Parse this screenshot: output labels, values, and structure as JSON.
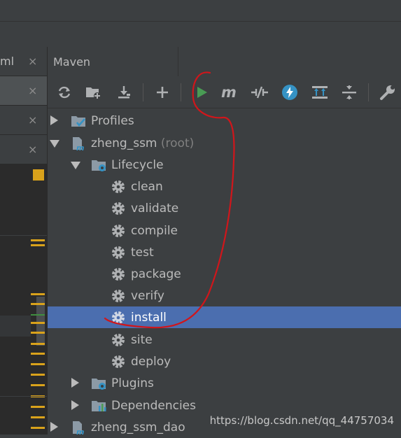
{
  "left_tabs": [
    {
      "label": "ml",
      "close": "×"
    },
    {
      "label": "",
      "close": "×"
    },
    {
      "label": "",
      "close": "×"
    },
    {
      "label": "",
      "close": "×"
    }
  ],
  "maven": {
    "title": "Maven",
    "toolbar": [
      {
        "name": "reload-icon"
      },
      {
        "name": "add-maven-project-icon"
      },
      {
        "name": "download-sources-icon"
      },
      {
        "name": "add-icon"
      },
      {
        "name": "run-icon"
      },
      {
        "name": "execute-maven-goal-icon"
      },
      {
        "name": "toggle-offline-icon"
      },
      {
        "name": "skip-tests-icon"
      },
      {
        "name": "show-dependencies-icon"
      },
      {
        "name": "collapse-all-icon"
      },
      {
        "name": "settings-wrench-icon"
      }
    ],
    "tree": {
      "profiles": "Profiles",
      "project": "zheng_ssm",
      "project_hint": "(root)",
      "lifecycle": "Lifecycle",
      "goals": [
        "clean",
        "validate",
        "compile",
        "test",
        "package",
        "verify",
        "install",
        "site",
        "deploy"
      ],
      "selected_goal": "install",
      "plugins": "Plugins",
      "dependencies": "Dependencies",
      "next_project": "zheng_ssm_dao"
    }
  },
  "watermark": "https://blog.csdn.net/qq_44757034",
  "colors": {
    "selection": "#4b6eaf",
    "run_green": "#499c54",
    "annotation_red": "#d0161b",
    "accent_blue": "#3592c4"
  }
}
